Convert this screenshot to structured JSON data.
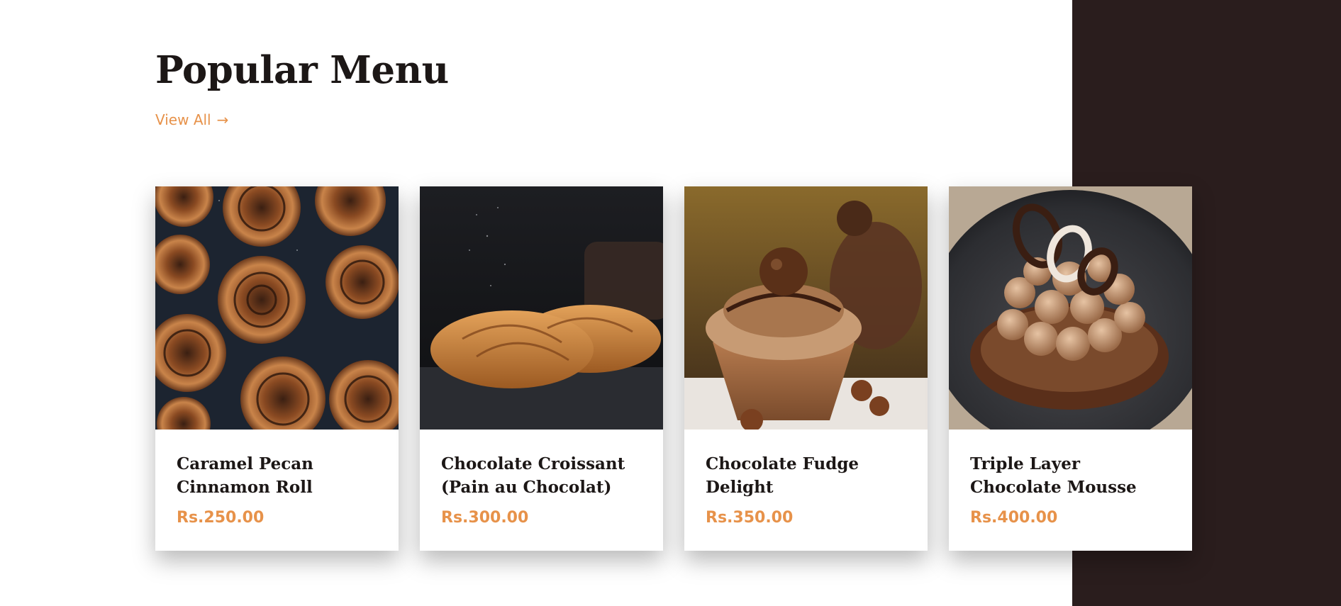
{
  "section": {
    "title": "Popular Menu",
    "view_all_label": "View All",
    "view_all_arrow": "→"
  },
  "colors": {
    "accent": "#e7924a",
    "dark_panel": "#2a1d1d",
    "title": "#1c1716"
  },
  "menu": {
    "items": [
      {
        "name": "Caramel Pecan Cinnamon Roll",
        "price": "Rs.250.00",
        "image": "cinnamon-rolls"
      },
      {
        "name": "Chocolate Croissant (Pain au Chocolat)",
        "price": "Rs.300.00",
        "image": "croissants"
      },
      {
        "name": "Chocolate Fudge Delight",
        "price": "Rs.350.00",
        "image": "chocolate-cupcake"
      },
      {
        "name": "Triple Layer Chocolate Mousse",
        "price": "Rs.400.00",
        "image": "chocolate-mousse"
      }
    ]
  }
}
